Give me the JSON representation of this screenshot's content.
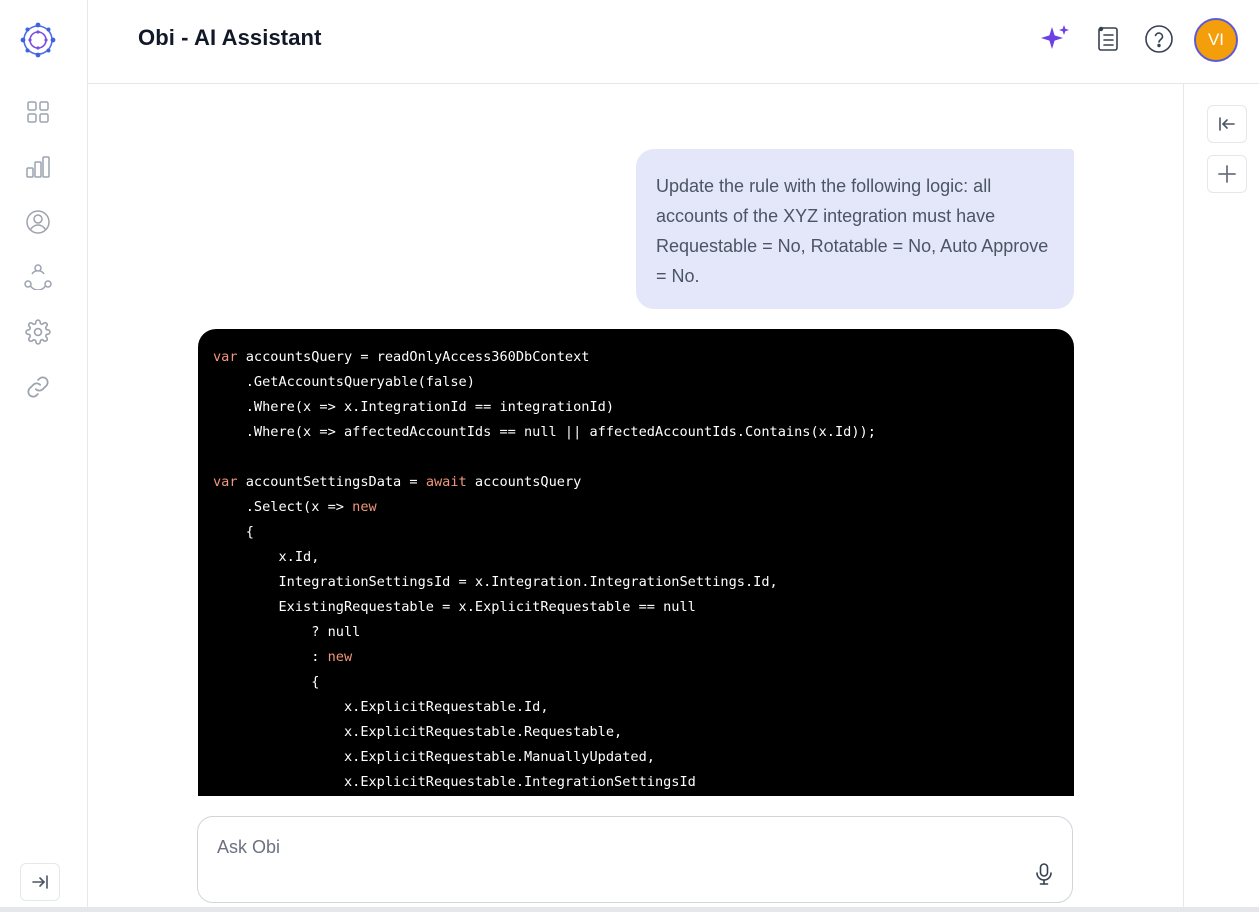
{
  "header": {
    "title": "Obi - AI Assistant",
    "avatar_initials": "VI",
    "avatar_color": "#f59e0b",
    "icons": [
      "sparkle-icon",
      "notes-list-icon",
      "help-icon"
    ]
  },
  "sidebar": {
    "items": [
      {
        "icon": "grid-icon"
      },
      {
        "icon": "bar-chart-icon"
      },
      {
        "icon": "user-icon"
      },
      {
        "icon": "network-icon"
      },
      {
        "icon": "settings-icon"
      },
      {
        "icon": "link-icon"
      }
    ],
    "collapse_icon": "expand-sidebar-icon"
  },
  "right_panel": {
    "buttons": [
      {
        "icon": "collapse-panel-icon"
      },
      {
        "icon": "plus-icon"
      }
    ]
  },
  "conversation": {
    "user_message": "Update the rule with the following logic: all accounts of the XYZ integration must have Requestable = No, Rotatable = No, Auto Approve = No.",
    "code_lines": [
      "var accountsQuery = readOnlyAccess360DbContext",
      "    .GetAccountsQueryable(false)",
      "    .Where(x => x.IntegrationId == integrationId)",
      "    .Where(x => affectedAccountIds == null || affectedAccountIds.Contains(x.Id));",
      "",
      "var accountSettingsData = await accountsQuery",
      "    .Select(x => new",
      "    {",
      "        x.Id,",
      "        IntegrationSettingsId = x.Integration.IntegrationSettings.Id,",
      "        ExistingRequestable = x.ExplicitRequestable == null",
      "            ? null",
      "            : new",
      "            {",
      "                x.ExplicitRequestable.Id,",
      "                x.ExplicitRequestable.Requestable,",
      "                x.ExplicitRequestable.ManuallyUpdated,",
      "                x.ExplicitRequestable.IntegrationSettingsId"
    ],
    "keywords": [
      "var",
      "await",
      "new"
    ]
  },
  "input": {
    "placeholder": "Ask Obi",
    "mic_icon": "microphone-icon"
  },
  "colors": {
    "accent": "#5b5bd6",
    "user_bubble": "#e4e6fa",
    "keyword": "#f0977a"
  }
}
